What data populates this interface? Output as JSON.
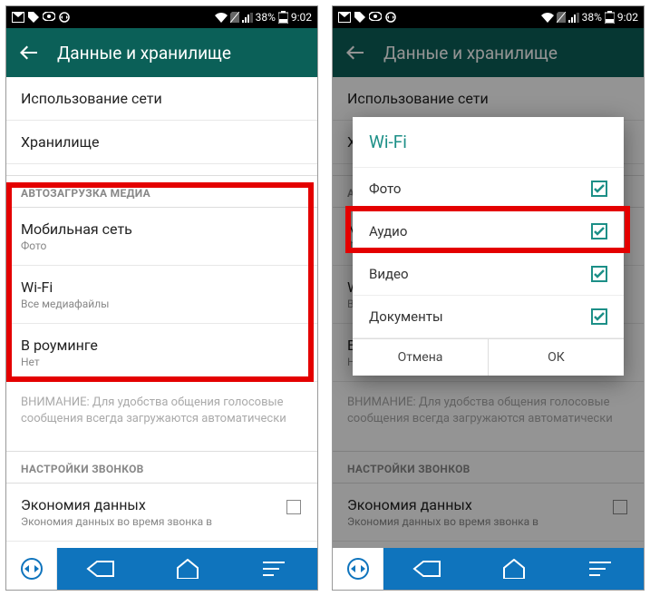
{
  "statusbar": {
    "battery_pct": "38%",
    "time": "9:02"
  },
  "appbar": {
    "title": "Данные и хранилище"
  },
  "rows": {
    "network_usage": "Использование сети",
    "storage": "Хранилище"
  },
  "section_autodownload": "АВТОЗАГРУЗКА МЕДИА",
  "mobile": {
    "title": "Мобильная сеть",
    "sub": "Фото"
  },
  "wifi": {
    "title": "Wi-Fi",
    "sub": "Все медиафайлы"
  },
  "roaming": {
    "title": "В роуминге",
    "sub": "Нет"
  },
  "warning": "ВНИМАНИЕ: Для удобства общения голосовые сообщения всегда загружаются автоматически",
  "section_calls": "НАСТРОЙКИ ЗВОНКОВ",
  "economy": {
    "title": "Экономия данных",
    "sub": "Экономия данных во время звонка в"
  },
  "dialog": {
    "title": "Wi-Fi",
    "opt_photo": "Фото",
    "opt_audio": "Аудио",
    "opt_video": "Видео",
    "opt_docs": "Документы",
    "cancel": "Отмена",
    "ok": "ОК"
  }
}
